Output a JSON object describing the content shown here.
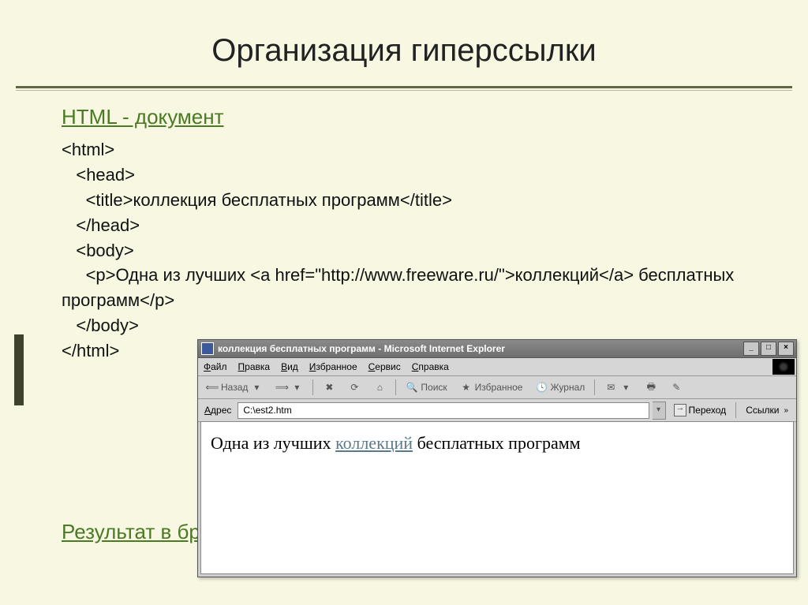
{
  "slide": {
    "title": "Организация гиперссылки",
    "html_doc_label": "HTML - документ",
    "result_label": "Результат в браузере",
    "code": "<html>\n   <head>\n     <title>коллекция бесплатных программ</title>\n   </head>\n   <body>\n     <p>Одна из лучших <a href=\"http://www.freeware.ru/\">коллекций</a> бесплатных программ</p>\n   </body>\n</html>"
  },
  "browser": {
    "title": "коллекция бесплатных программ - Microsoft Internet Explorer",
    "menu": {
      "file": "Файл",
      "edit": "Правка",
      "view": "Вид",
      "favorites": "Избранное",
      "tools": "Сервис",
      "help": "Справка"
    },
    "toolbar": {
      "back": "Назад",
      "search": "Поиск",
      "favorites": "Избранное",
      "history": "Журнал"
    },
    "address": {
      "label": "Адрес",
      "value": "C:\\est2.htm",
      "go": "Переход",
      "links": "Ссылки"
    },
    "page": {
      "text_before": "Одна из лучших ",
      "link": "коллекций",
      "text_after": " бесплатных программ"
    }
  }
}
